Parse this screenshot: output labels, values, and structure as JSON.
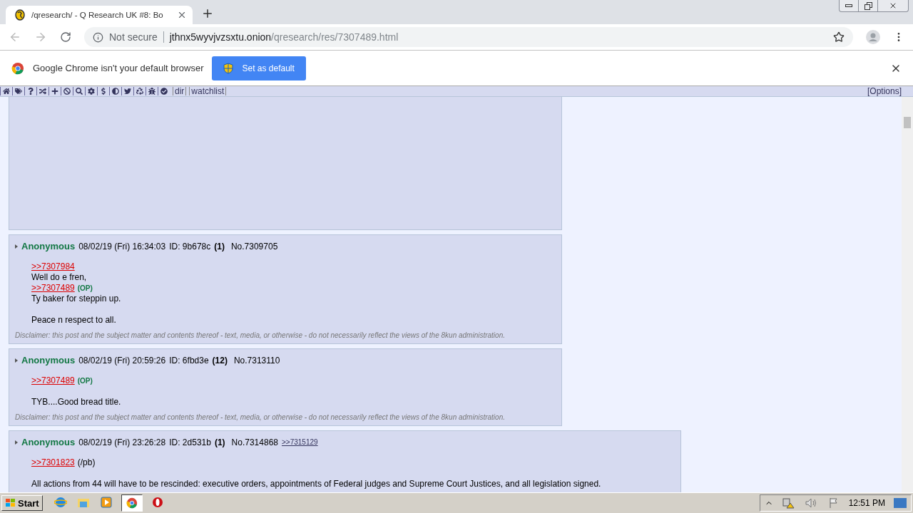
{
  "browser": {
    "tab": {
      "title": "/qresearch/ - Q Research UK #8: Bo",
      "selected": true
    },
    "address": {
      "security": "Not secure",
      "host": "jthnx5wyvjvzsxtu.onion",
      "path": "/qresearch/res/7307489.html"
    }
  },
  "infobar": {
    "message": "Google Chrome isn't your default browser",
    "button": "Set as default"
  },
  "board_bar": {
    "links": [
      "dir",
      "watchlist"
    ],
    "options": "[Options]"
  },
  "posts": [
    {
      "name": "Anonymous",
      "date": "08/02/19 (Fri) 16:34:03",
      "id": "ID: 9b678c",
      "count": "(1)",
      "number": "No.7309705",
      "wide": false,
      "body": [
        {
          "kind": "link",
          "text": ">>7307984"
        },
        {
          "kind": "text",
          "text": "Well do e fren,"
        },
        {
          "kind": "link",
          "text": ">>7307489",
          "tag": {
            "kind": "op",
            "text": "(OP)"
          }
        },
        {
          "kind": "text",
          "text": "Ty baker for steppin up."
        },
        {
          "kind": "gap"
        },
        {
          "kind": "text",
          "text": "Peace n respect to all."
        }
      ],
      "disclaimer": "Disclaimer: this post and the subject matter and contents thereof - text, media, or otherwise - do not necessarily reflect the views of the 8kun administration."
    },
    {
      "name": "Anonymous",
      "date": "08/02/19 (Fri) 20:59:26",
      "id": "ID: 6fbd3e",
      "count": "(12)",
      "number": "No.7313110",
      "wide": false,
      "body": [
        {
          "kind": "link",
          "text": ">>7307489",
          "tag": {
            "kind": "op",
            "text": "(OP)"
          }
        },
        {
          "kind": "gap"
        },
        {
          "kind": "text",
          "text": "TYB....Good bread title."
        }
      ],
      "disclaimer": "Disclaimer: this post and the subject matter and contents thereof - text, media, or otherwise - do not necessarily reflect the views of the 8kun administration."
    },
    {
      "name": "Anonymous",
      "date": "08/02/19 (Fri) 23:26:28",
      "id": "ID: 2d531b",
      "count": "(1)",
      "number": "No.7314868",
      "backlink": ">>7315129",
      "wide": true,
      "body": [
        {
          "kind": "link",
          "text": ">>7301823",
          "tag": {
            "kind": "plain",
            "text": "(/pb)"
          }
        },
        {
          "kind": "gap"
        },
        {
          "kind": "text",
          "text": "All actions from 44 will have to be rescinded: executive orders, appointments of Federal judges and Supreme Court Justices, and all legislation signed."
        }
      ]
    }
  ],
  "taskbar": {
    "start": "Start",
    "clock": "12:51 PM"
  }
}
